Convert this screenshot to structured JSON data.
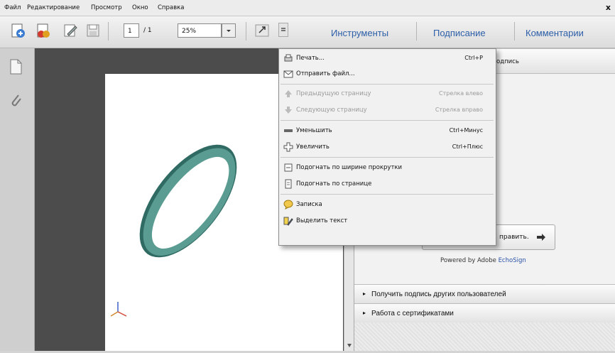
{
  "menubar": {
    "items": [
      "Файл",
      "Редактирование",
      "Просмотр",
      "Окно",
      "Справка"
    ],
    "close": "x"
  },
  "toolbar": {
    "page_current": "1",
    "page_total": "/ 1",
    "zoom": "25%",
    "tabs": [
      "Инструменты",
      "Подписание",
      "Комментарии"
    ]
  },
  "menu": {
    "items": [
      {
        "label": "Печать...",
        "shortcut": "Ctrl+P",
        "icon": "print-icon",
        "enabled": true
      },
      {
        "label": "Отправить файл...",
        "shortcut": "",
        "icon": "envelope-icon",
        "enabled": true
      },
      {
        "label": "Предыдущую страницу",
        "shortcut": "Стрелка влево",
        "icon": "arrow-up-icon",
        "enabled": false
      },
      {
        "label": "Следующую страницу",
        "shortcut": "Стрелка вправо",
        "icon": "arrow-down-icon",
        "enabled": false
      },
      {
        "label": "Уменьшить",
        "shortcut": "Ctrl+Минус",
        "icon": "zoom-out-icon",
        "enabled": true
      },
      {
        "label": "Увеличить",
        "shortcut": "Ctrl+Плюс",
        "icon": "zoom-in-icon",
        "enabled": true
      },
      {
        "label": "Подогнать по ширине прокрутки",
        "shortcut": "",
        "icon": "fit-width-icon",
        "enabled": true
      },
      {
        "label": "Подогнать по странице",
        "shortcut": "",
        "icon": "fit-page-icon",
        "enabled": true
      },
      {
        "label": "Записка",
        "shortcut": "",
        "icon": "note-icon",
        "enabled": true
      },
      {
        "label": "Выделить текст",
        "shortcut": "",
        "icon": "highlight-icon",
        "enabled": true
      }
    ]
  },
  "rightpanel": {
    "header_partial": "одпись",
    "send_button": "править.",
    "powered_prefix": "Powered by Adobe ",
    "powered_brand": "EchoSign",
    "sections": [
      "Получить подпись других пользователей",
      "Работа с сертификатами"
    ]
  },
  "colors": {
    "ring": "#3f7d74",
    "canvas": "#4c4c4c",
    "accent": "#2d5fa8"
  }
}
